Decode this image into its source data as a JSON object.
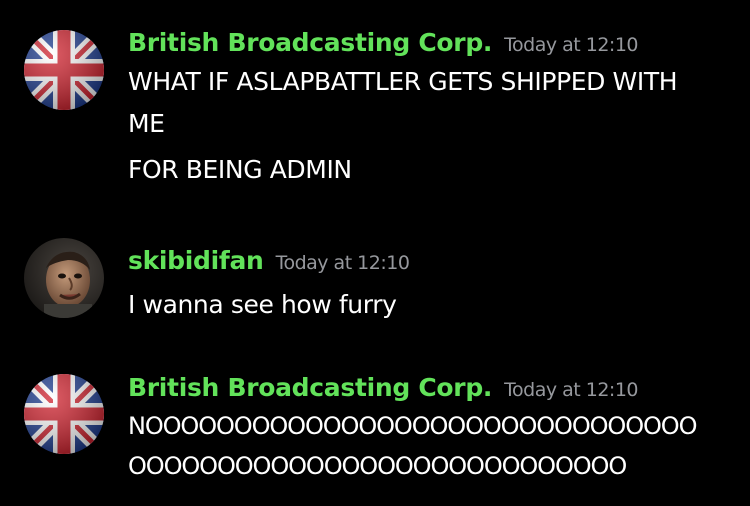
{
  "messages": [
    {
      "author": "British Broadcasting Corp.",
      "timestamp": "Today at 12:10",
      "avatar_icon": "union-jack-flag-icon",
      "lines": [
        "WHAT IF ASLAPBATTLER GETS SHIPPED WITH",
        "ME",
        "FOR BEING ADMIN"
      ]
    },
    {
      "author": "skibidifan",
      "timestamp": "Today at 12:10",
      "avatar_icon": "face-avatar-icon",
      "lines": [
        "I wanna see how furry"
      ]
    },
    {
      "author": "British Broadcasting Corp.",
      "timestamp": "Today at 12:10",
      "avatar_icon": "union-jack-flag-icon",
      "lines": [
        "NOOOOOOOOOOOOOOOOOOOOOOOOOOOOOOO",
        "OOOOOOOOOOOOOOOOOOOOOOOOOOOO"
      ]
    }
  ],
  "colors": {
    "username": "#62e25a",
    "timestamp": "#96989d",
    "background": "#000000",
    "text": "#ffffff"
  }
}
